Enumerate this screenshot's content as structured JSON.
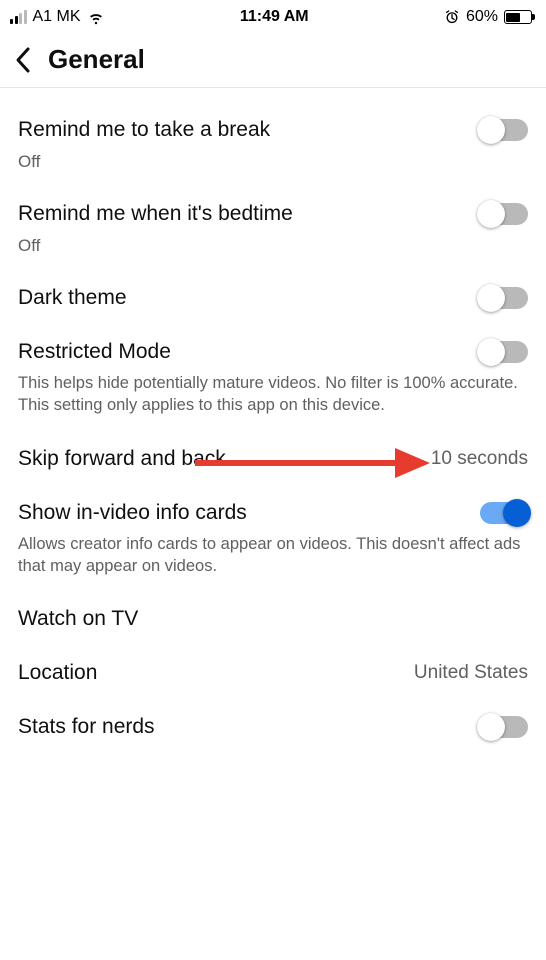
{
  "status": {
    "carrier": "A1 MK",
    "time": "11:49 AM",
    "battery_percent": "60%"
  },
  "header": {
    "title": "General"
  },
  "settings": {
    "break": {
      "title": "Remind me to take a break",
      "status": "Off"
    },
    "bedtime": {
      "title": "Remind me when it's bedtime",
      "status": "Off"
    },
    "dark": {
      "title": "Dark theme"
    },
    "restricted": {
      "title": "Restricted Mode",
      "desc": "This helps hide potentially mature videos. No filter is 100% accurate. This setting only applies to this app on this device."
    },
    "skip": {
      "title": "Skip forward and back",
      "value": "10 seconds"
    },
    "infocards": {
      "title": "Show in-video info cards",
      "desc": "Allows creator info cards to appear on videos. This doesn't affect ads that may appear on videos."
    },
    "watchtv": {
      "title": "Watch on TV"
    },
    "location": {
      "title": "Location",
      "value": "United States"
    },
    "statsnerds": {
      "title": "Stats for nerds"
    }
  },
  "colors": {
    "accent": "#065fd4",
    "annotation": "#e63b2e"
  }
}
